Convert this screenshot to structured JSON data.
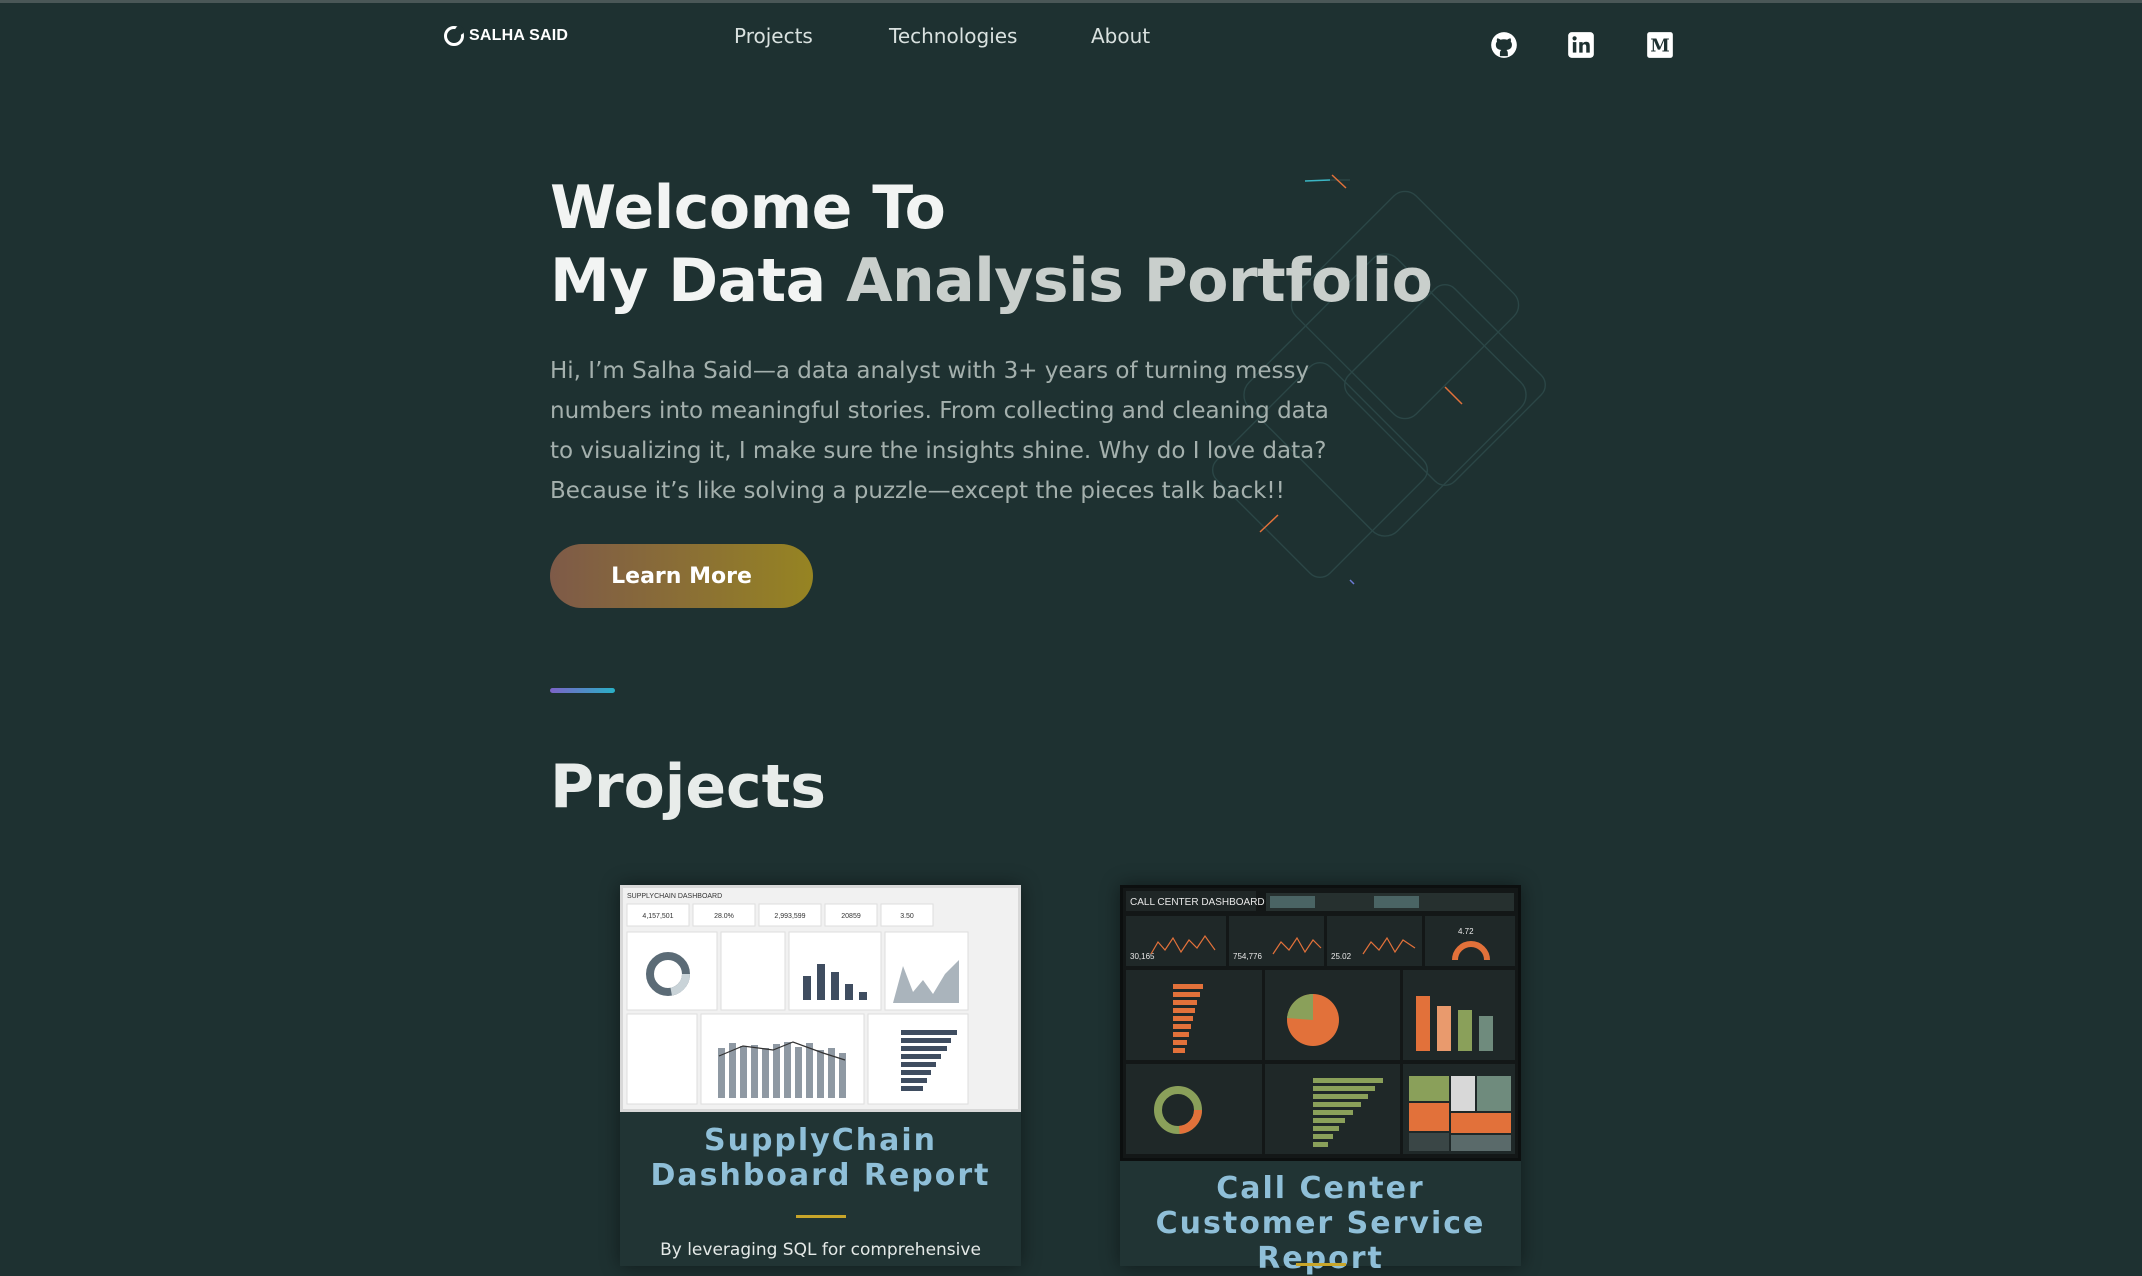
{
  "header": {
    "logo_text": "SALHA SAID",
    "nav": [
      {
        "label": "Projects"
      },
      {
        "label": "Technologies"
      },
      {
        "label": "About"
      }
    ],
    "social_icons": [
      "github-icon",
      "linkedin-icon",
      "medium-icon"
    ],
    "medium_letter": "M"
  },
  "hero": {
    "title_line1": "Welcome To",
    "title_line2_a": "My Data",
    "title_line2_b": "Analysis Portfolio",
    "description": "Hi, I’m Salha Said—a data analyst with 3+ years of turning messy numbers into meaningful stories. From collecting and cleaning data to visualizing it, I make sure the insights shine. Why do I love data? Because it’s like solving a puzzle—except the pieces talk back!!",
    "cta_label": "Learn More"
  },
  "projects": {
    "section_title": "Projects",
    "cards": [
      {
        "title": "SupplyChain Dashboard Report",
        "excerpt": "By leveraging SQL for comprehensive",
        "thumb": {
          "header": "SUPPLYCHAIN DASHBOARD",
          "kpis": [
            "4,157,501",
            "28.0%",
            "2,993,599",
            "20859",
            "3.50"
          ]
        }
      },
      {
        "title": "Call Center Customer Service Report",
        "excerpt": "",
        "thumb": {
          "header": "CALL CENTER DASHBOARD",
          "kpis": [
            "30,165",
            "754,776",
            "25.02",
            "4.72"
          ]
        }
      }
    ]
  },
  "colors": {
    "background": "#1e3131",
    "accent_gold": "#c8a52a",
    "card_title": "#8fbfd8",
    "bar_orange": "#e2713a",
    "bar_green": "#8aa05a"
  }
}
